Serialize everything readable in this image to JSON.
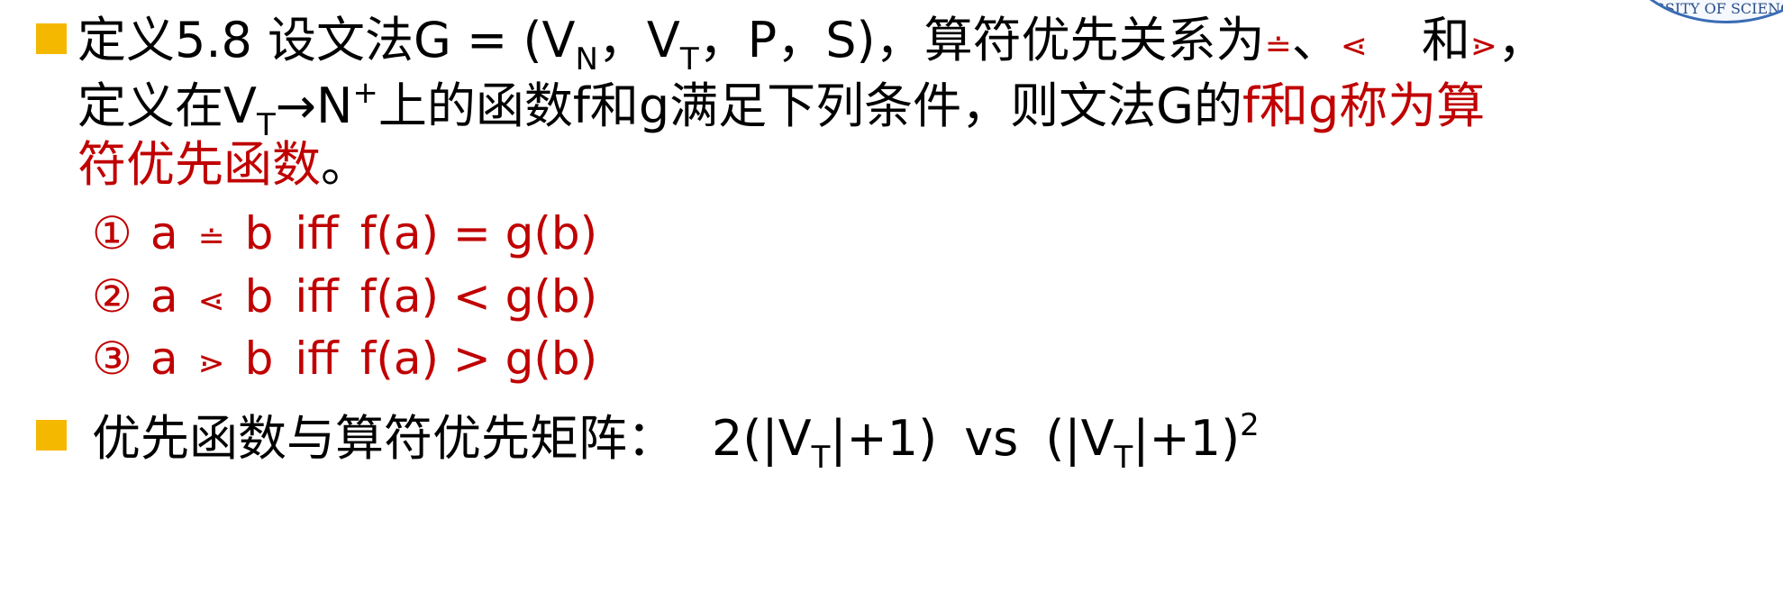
{
  "logo": {
    "text": "RSITY OF SCIENCE"
  },
  "definition": {
    "prefix": "定义5.8 设文法G = (V",
    "sub_n": "N",
    "mid1": "，V",
    "sub_t1": "T",
    "mid2": "，P，S)，算符优先关系为",
    "eq_sym": "≐",
    "sep1": "、",
    "lt_sym": "⋖",
    "and_word": "和",
    "gt_sym": "⋗",
    "comma_end": "，",
    "line2_a": "定义在V",
    "sub_t2": "T",
    "line2_b": "→N",
    "sup_plus": "+",
    "line2_c": "上的函数f和g满足下列条件，则文法G的",
    "red_1": "f和g称为算",
    "red_2": "符优先函数",
    "period": "。"
  },
  "conditions": [
    {
      "num": "①",
      "a": "a",
      "op": "≐",
      "b": "b",
      "iff": "iff",
      "expr": "f(a) = g(b)"
    },
    {
      "num": "②",
      "a": "a",
      "op": "⋖",
      "b": "b",
      "iff": "iff",
      "expr": "f(a) < g(b)"
    },
    {
      "num": "③",
      "a": "a",
      "op": "⋗",
      "b": "b",
      "iff": "iff",
      "expr": "f(a) > g(b)"
    }
  ],
  "comparison": {
    "label": "优先函数与算符优先矩阵：",
    "left_a": "2(|V",
    "left_sub": "T",
    "left_b": "|+1)",
    "vs": "vs",
    "right_a": "(|V",
    "right_sub": "T",
    "right_b": "|+1)",
    "right_sup": "2"
  },
  "colors": {
    "bullet": "#f5b800",
    "highlight": "#c00000",
    "text": "#000000"
  }
}
